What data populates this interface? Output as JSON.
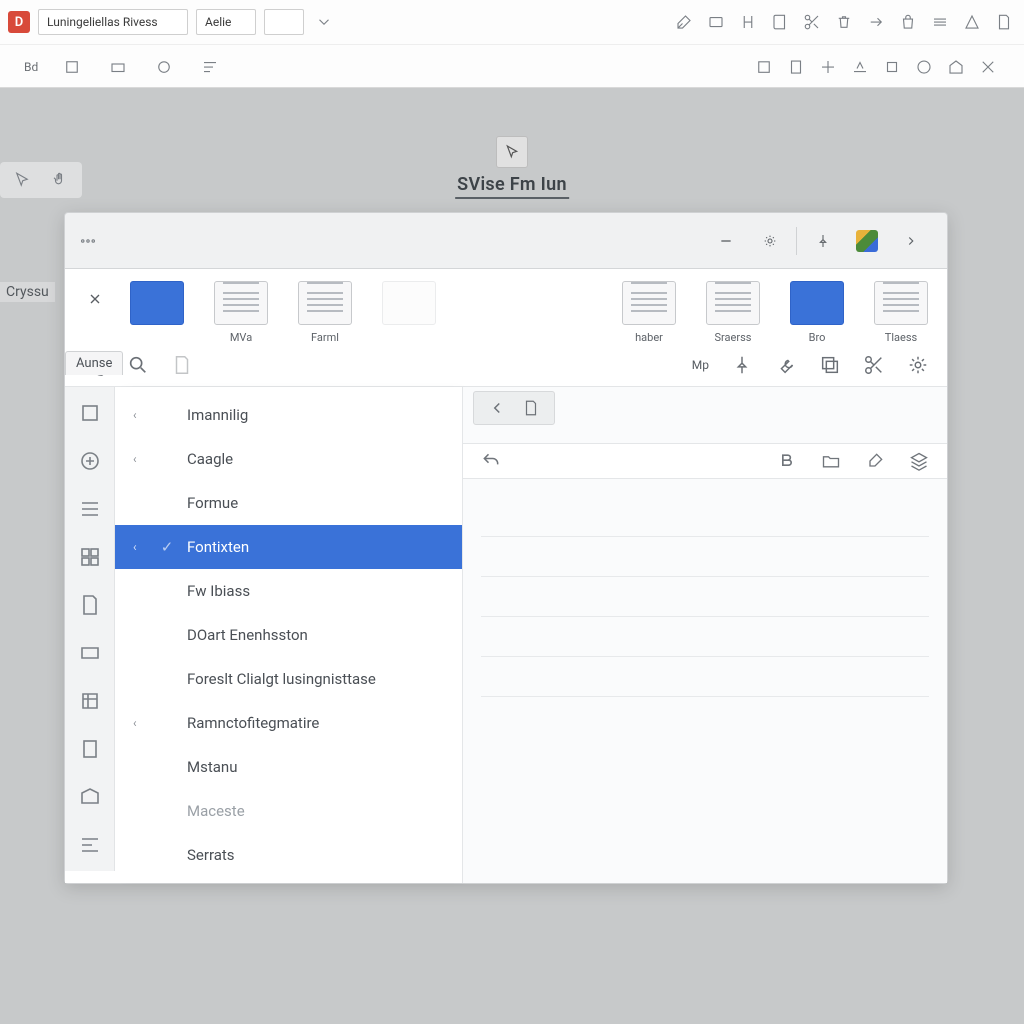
{
  "ribbon": {
    "app_badge": "D",
    "field1": "Luningeliellas Rivess",
    "field2": "Aelie",
    "row2_labels": [
      "Bd"
    ]
  },
  "canvas": {
    "doc_title": "SVise Fm Iun",
    "side_word": "Cryssu"
  },
  "dialog": {
    "rail_badge": "Aunse",
    "shelf": [
      {
        "label": ""
      },
      {
        "label": "MVa"
      },
      {
        "label": "Farml"
      },
      {
        "label": ""
      },
      {
        "label": "haber"
      },
      {
        "label": "Sraerss"
      },
      {
        "label": "Bro"
      },
      {
        "label": "Tlaess"
      }
    ],
    "toolstrip_word": "Mp",
    "menu": {
      "items": [
        {
          "label": "Imannilig",
          "has_chevron": true
        },
        {
          "label": "Caagle",
          "has_chevron": true
        },
        {
          "label": "Formue",
          "has_chevron": false
        },
        {
          "label": "Fontixten",
          "has_chevron": true,
          "selected": true
        },
        {
          "label": "Fw Ibiass",
          "has_chevron": false
        },
        {
          "label": "DOart Enenhsston",
          "has_chevron": false
        },
        {
          "label": "Foreslt Clialgt lusingnisttase",
          "has_chevron": false
        },
        {
          "label": "Ramnctofitegmatire",
          "has_chevron": true
        },
        {
          "label": "Mstanu",
          "has_chevron": false
        },
        {
          "label": "Maceste",
          "has_chevron": false
        },
        {
          "label": "Serrats",
          "has_chevron": false
        }
      ]
    }
  }
}
